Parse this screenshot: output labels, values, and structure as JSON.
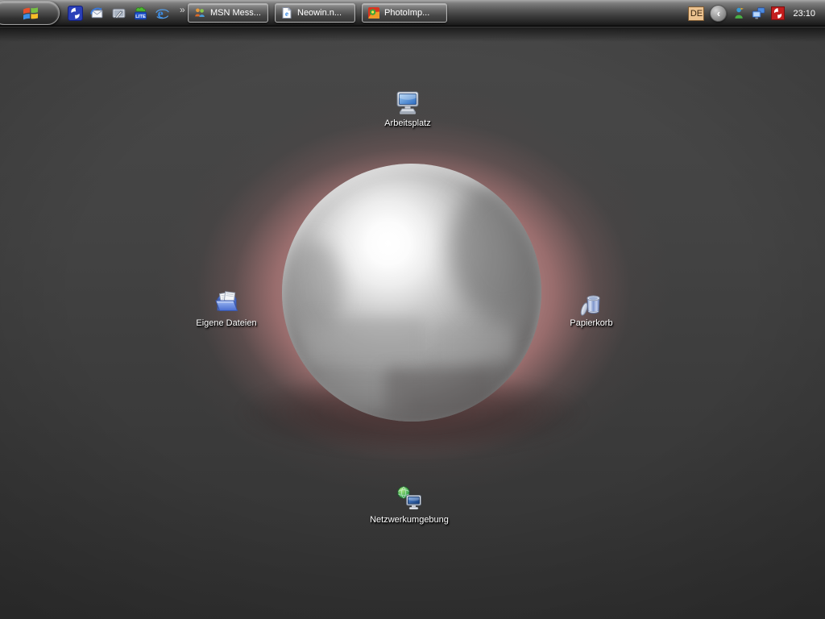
{
  "taskbar": {
    "start": {
      "tooltip": "Start"
    },
    "quick_launch": {
      "items": [
        {
          "name": "blue-swoosh-app"
        },
        {
          "name": "outlook-express"
        },
        {
          "name": "show-desktop"
        },
        {
          "name": "lite-app",
          "badge": "LITE"
        },
        {
          "name": "internet-explorer"
        }
      ],
      "overflow_chevron": "»"
    },
    "window_buttons": [
      {
        "label": "MSN Mess...",
        "icon": "msn-messenger"
      },
      {
        "label": "Neowin.n...",
        "icon": "ie-document"
      },
      {
        "label": "PhotoImp...",
        "icon": "photoimpact"
      }
    ],
    "tray": {
      "language_badge": "DE",
      "collapse_chevron": "‹",
      "icons": [
        {
          "name": "messenger-status"
        },
        {
          "name": "network-connection"
        },
        {
          "name": "red-swoosh-app"
        }
      ],
      "clock": "23:10"
    }
  },
  "desktop": {
    "icons": [
      {
        "label": "Arbeitsplatz",
        "icon": "my-computer"
      },
      {
        "label": "Eigene Dateien",
        "icon": "my-documents"
      },
      {
        "label": "Papierkorb",
        "icon": "recycle-bin"
      },
      {
        "label": "Netzwerkumgebung",
        "icon": "network-places"
      }
    ]
  },
  "colors": {
    "glow": "#b58585",
    "desktop_base": "#3d3d3d",
    "taskbar_dark": "#2a2a2a",
    "badge_tan": "#ecc28f"
  }
}
